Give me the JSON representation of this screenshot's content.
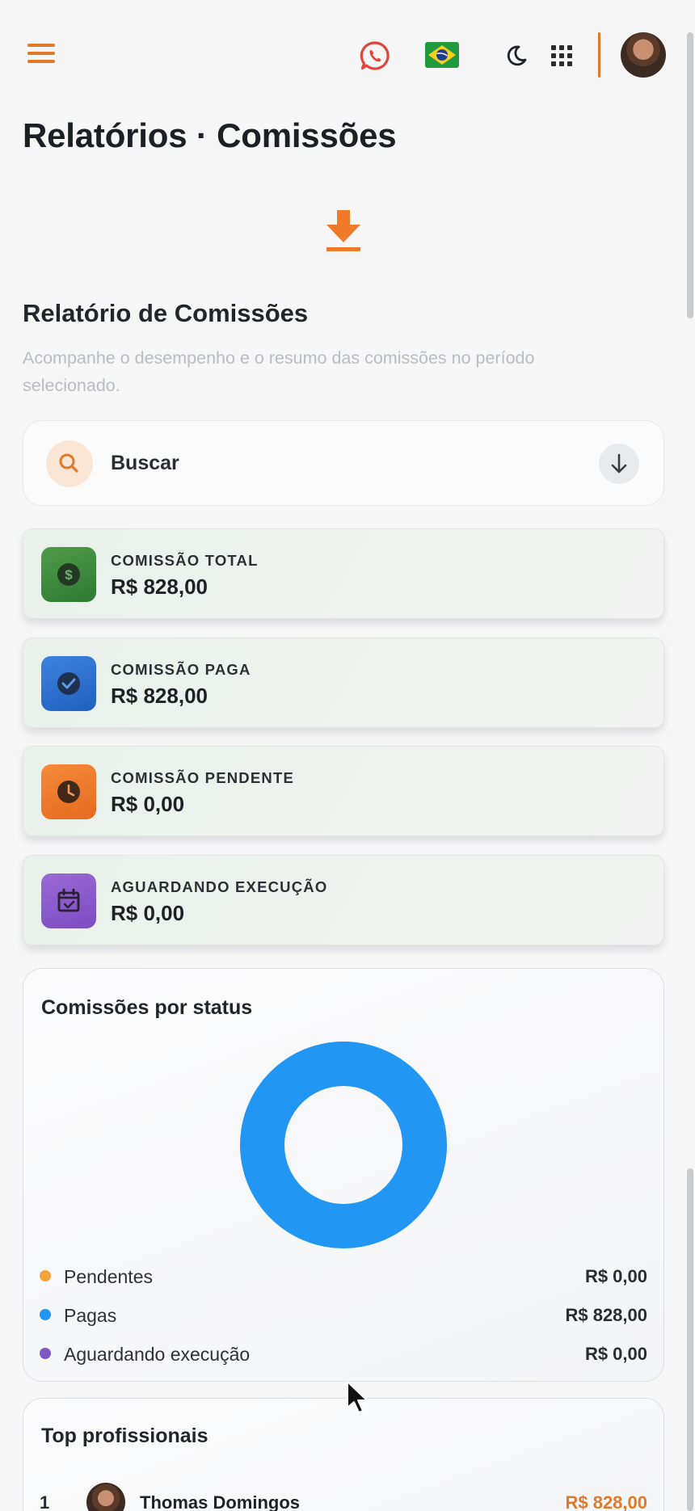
{
  "header": {
    "menu_icon": "hamburger-menu-icon",
    "whatsapp_icon": "whatsapp-icon",
    "language_flag": "brazil-flag-icon",
    "theme_icon": "moon-icon",
    "apps_icon": "grid-icon",
    "accent_color": "#e07a28"
  },
  "page": {
    "title": "Relatórios · Comissões"
  },
  "report": {
    "download_icon": "download-icon",
    "title": "Relatório de Comissões",
    "subtitle": "Acompanhe o desempenho e o resumo das comissões no período selecionado."
  },
  "search": {
    "label": "Buscar",
    "icon": "search-icon",
    "expand_icon": "arrow-down-icon"
  },
  "stats": [
    {
      "label": "COMISSÃO TOTAL",
      "value": "R$ 828,00",
      "icon": "dollar-icon",
      "color": "#3f8a3d"
    },
    {
      "label": "COMISSÃO PAGA",
      "value": "R$ 828,00",
      "icon": "check-circle-icon",
      "color": "#2f6fcf"
    },
    {
      "label": "COMISSÃO PENDENTE",
      "value": "R$ 0,00",
      "icon": "clock-icon",
      "color": "#f07a2e"
    },
    {
      "label": "AGUARDANDO EXECUÇÃO",
      "value": "R$ 0,00",
      "icon": "calendar-check-icon",
      "color": "#8a5cc8"
    }
  ],
  "chart_card": {
    "title": "Comissões por status"
  },
  "chart_data": {
    "type": "pie",
    "subtype": "donut",
    "categories": [
      "Pendentes",
      "Pagas",
      "Aguardando execução"
    ],
    "values": [
      0,
      828,
      0
    ],
    "value_labels": [
      "R$ 0,00",
      "R$ 828,00",
      "R$ 0,00"
    ],
    "colors": [
      "#f2a33a",
      "#2196f3",
      "#7e57c2"
    ],
    "legend": "bottom"
  },
  "top_professionals": {
    "title": "Top profissionais",
    "items": [
      {
        "rank": "1",
        "name": "Thomas Domingos",
        "value": "R$ 828,00"
      }
    ]
  }
}
